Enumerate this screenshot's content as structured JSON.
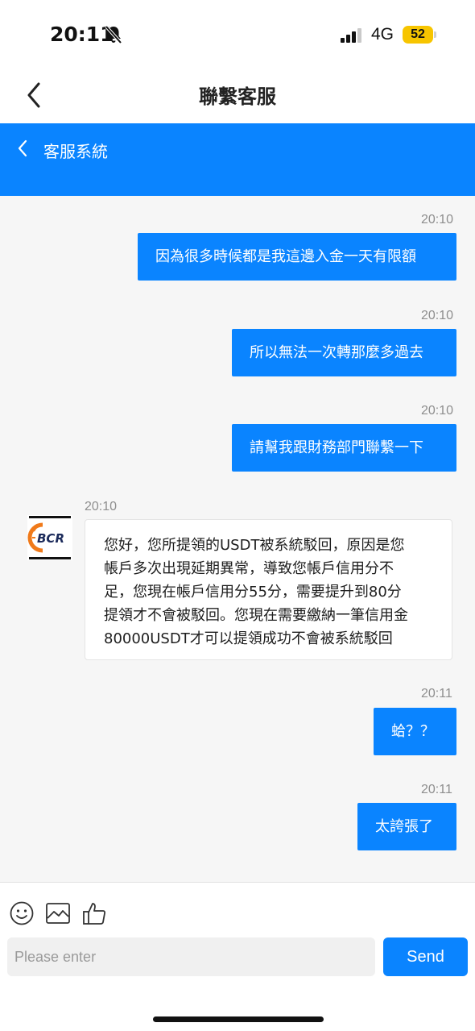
{
  "status_bar": {
    "time": "20:11",
    "network": "4G",
    "battery": "52"
  },
  "nav": {
    "title": "聯繫客服"
  },
  "cs_header": {
    "title": "客服系統"
  },
  "messages": [
    {
      "time": "20:10",
      "text": "因為很多時候都是我這邊入金一天有限額"
    },
    {
      "time": "20:10",
      "text": "所以無法一次轉那麼多過去"
    },
    {
      "time": "20:10",
      "text": "請幫我跟財務部門聯繫一下"
    },
    {
      "time": "20:10",
      "lines": [
        "您好，您所提領的USDT被系統駁回，原因是您",
        "帳戶多次出現延期異常，導致您帳戶信用分不",
        "足，您現在帳戶信用分55分，需要提升到80分",
        "提領才不會被駁回。您現在需要繳納一筆信用金",
        "80000USDT才可以提領成功不會被系統駁回"
      ]
    },
    {
      "time": "20:11",
      "text": "蛤？？"
    },
    {
      "time": "20:11",
      "text": "太誇張了"
    }
  ],
  "avatar_logo": "BCR",
  "composer": {
    "placeholder": "Please enter",
    "send_label": "Send"
  },
  "colors": {
    "accent": "#0a84ff",
    "chat_background": "#f6f6f6"
  },
  "icons": [
    "bell-off-icon",
    "signal-icon",
    "back-arrow-icon",
    "emoji-icon",
    "image-icon",
    "thumbs-up-icon"
  ]
}
